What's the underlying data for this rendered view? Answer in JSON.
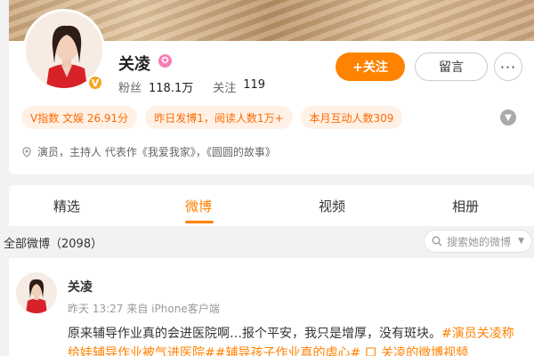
{
  "profile": {
    "name": "关凌",
    "stats": {
      "followers_label": "粉丝",
      "followers_value": "118.1万",
      "following_label": "关注",
      "following_value": "119"
    },
    "follow_button": "+关注",
    "message_button": "留言",
    "more_button": "···",
    "chips": [
      "V指数 文娱 26.91分",
      "昨日发博1，阅读人数1万+",
      "本月互动人数309"
    ],
    "bio": "演员，主持人 代表作《我爱我家》，《圆圆的故事》"
  },
  "tabs": [
    "精选",
    "微博",
    "视频",
    "相册"
  ],
  "active_tab": "微博",
  "feed": {
    "all_posts_label": "全部微博（2098）",
    "search_placeholder": "搜索她的微博"
  },
  "post": {
    "author": "关凌",
    "time": "昨天 13:27",
    "source": "来自 iPhone客户端",
    "text": "原来辅导作业真的会进医院啊…报个平安，我只是增厚，没有斑块。",
    "hashtag1": "#演员关凌称",
    "line2": "给娃辅导作业被气进医院##辅导孩子作业真的虐心# 口 关凌的微博视频"
  },
  "colors": {
    "accent": "#ff8200",
    "chip_bg": "#fff1e6",
    "chip_text": "#ff6a00",
    "verified": "#f5a623"
  }
}
